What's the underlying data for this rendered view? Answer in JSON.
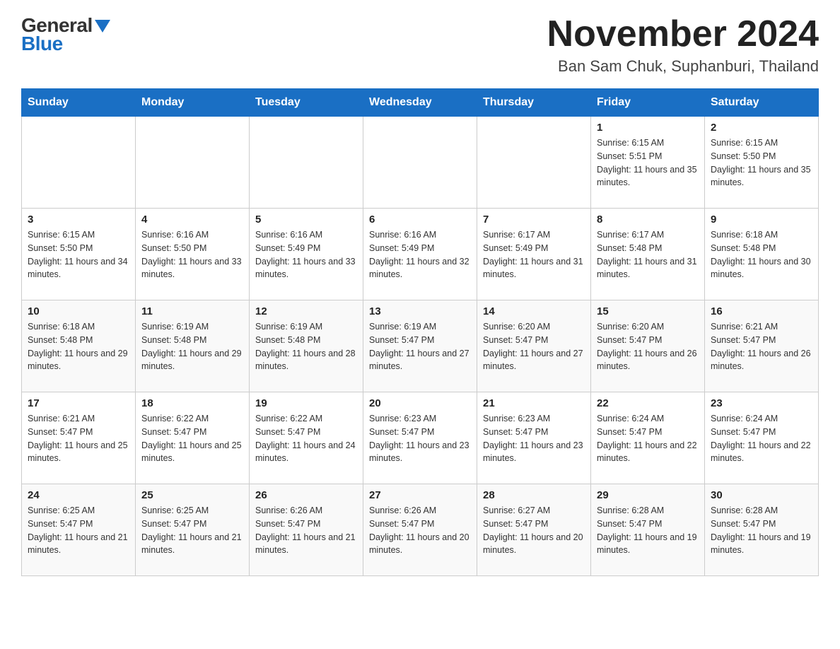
{
  "header": {
    "logo_general": "General",
    "logo_blue": "Blue",
    "month_title": "November 2024",
    "location": "Ban Sam Chuk, Suphanburi, Thailand"
  },
  "days_of_week": [
    "Sunday",
    "Monday",
    "Tuesday",
    "Wednesday",
    "Thursday",
    "Friday",
    "Saturday"
  ],
  "weeks": [
    [
      {
        "day": "",
        "info": ""
      },
      {
        "day": "",
        "info": ""
      },
      {
        "day": "",
        "info": ""
      },
      {
        "day": "",
        "info": ""
      },
      {
        "day": "",
        "info": ""
      },
      {
        "day": "1",
        "info": "Sunrise: 6:15 AM\nSunset: 5:51 PM\nDaylight: 11 hours and 35 minutes."
      },
      {
        "day": "2",
        "info": "Sunrise: 6:15 AM\nSunset: 5:50 PM\nDaylight: 11 hours and 35 minutes."
      }
    ],
    [
      {
        "day": "3",
        "info": "Sunrise: 6:15 AM\nSunset: 5:50 PM\nDaylight: 11 hours and 34 minutes."
      },
      {
        "day": "4",
        "info": "Sunrise: 6:16 AM\nSunset: 5:50 PM\nDaylight: 11 hours and 33 minutes."
      },
      {
        "day": "5",
        "info": "Sunrise: 6:16 AM\nSunset: 5:49 PM\nDaylight: 11 hours and 33 minutes."
      },
      {
        "day": "6",
        "info": "Sunrise: 6:16 AM\nSunset: 5:49 PM\nDaylight: 11 hours and 32 minutes."
      },
      {
        "day": "7",
        "info": "Sunrise: 6:17 AM\nSunset: 5:49 PM\nDaylight: 11 hours and 31 minutes."
      },
      {
        "day": "8",
        "info": "Sunrise: 6:17 AM\nSunset: 5:48 PM\nDaylight: 11 hours and 31 minutes."
      },
      {
        "day": "9",
        "info": "Sunrise: 6:18 AM\nSunset: 5:48 PM\nDaylight: 11 hours and 30 minutes."
      }
    ],
    [
      {
        "day": "10",
        "info": "Sunrise: 6:18 AM\nSunset: 5:48 PM\nDaylight: 11 hours and 29 minutes."
      },
      {
        "day": "11",
        "info": "Sunrise: 6:19 AM\nSunset: 5:48 PM\nDaylight: 11 hours and 29 minutes."
      },
      {
        "day": "12",
        "info": "Sunrise: 6:19 AM\nSunset: 5:48 PM\nDaylight: 11 hours and 28 minutes."
      },
      {
        "day": "13",
        "info": "Sunrise: 6:19 AM\nSunset: 5:47 PM\nDaylight: 11 hours and 27 minutes."
      },
      {
        "day": "14",
        "info": "Sunrise: 6:20 AM\nSunset: 5:47 PM\nDaylight: 11 hours and 27 minutes."
      },
      {
        "day": "15",
        "info": "Sunrise: 6:20 AM\nSunset: 5:47 PM\nDaylight: 11 hours and 26 minutes."
      },
      {
        "day": "16",
        "info": "Sunrise: 6:21 AM\nSunset: 5:47 PM\nDaylight: 11 hours and 26 minutes."
      }
    ],
    [
      {
        "day": "17",
        "info": "Sunrise: 6:21 AM\nSunset: 5:47 PM\nDaylight: 11 hours and 25 minutes."
      },
      {
        "day": "18",
        "info": "Sunrise: 6:22 AM\nSunset: 5:47 PM\nDaylight: 11 hours and 25 minutes."
      },
      {
        "day": "19",
        "info": "Sunrise: 6:22 AM\nSunset: 5:47 PM\nDaylight: 11 hours and 24 minutes."
      },
      {
        "day": "20",
        "info": "Sunrise: 6:23 AM\nSunset: 5:47 PM\nDaylight: 11 hours and 23 minutes."
      },
      {
        "day": "21",
        "info": "Sunrise: 6:23 AM\nSunset: 5:47 PM\nDaylight: 11 hours and 23 minutes."
      },
      {
        "day": "22",
        "info": "Sunrise: 6:24 AM\nSunset: 5:47 PM\nDaylight: 11 hours and 22 minutes."
      },
      {
        "day": "23",
        "info": "Sunrise: 6:24 AM\nSunset: 5:47 PM\nDaylight: 11 hours and 22 minutes."
      }
    ],
    [
      {
        "day": "24",
        "info": "Sunrise: 6:25 AM\nSunset: 5:47 PM\nDaylight: 11 hours and 21 minutes."
      },
      {
        "day": "25",
        "info": "Sunrise: 6:25 AM\nSunset: 5:47 PM\nDaylight: 11 hours and 21 minutes."
      },
      {
        "day": "26",
        "info": "Sunrise: 6:26 AM\nSunset: 5:47 PM\nDaylight: 11 hours and 21 minutes."
      },
      {
        "day": "27",
        "info": "Sunrise: 6:26 AM\nSunset: 5:47 PM\nDaylight: 11 hours and 20 minutes."
      },
      {
        "day": "28",
        "info": "Sunrise: 6:27 AM\nSunset: 5:47 PM\nDaylight: 11 hours and 20 minutes."
      },
      {
        "day": "29",
        "info": "Sunrise: 6:28 AM\nSunset: 5:47 PM\nDaylight: 11 hours and 19 minutes."
      },
      {
        "day": "30",
        "info": "Sunrise: 6:28 AM\nSunset: 5:47 PM\nDaylight: 11 hours and 19 minutes."
      }
    ]
  ]
}
